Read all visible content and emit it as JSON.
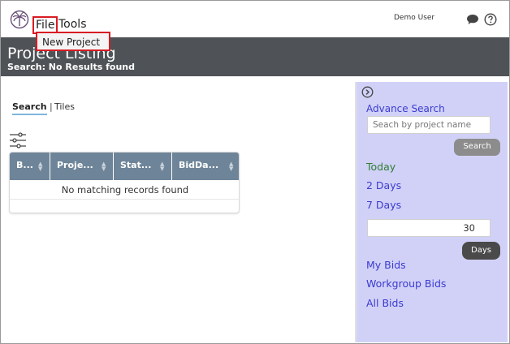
{
  "menu": {
    "file_label": "File",
    "tools_label": "Tools",
    "file_dropdown": {
      "new_project_label": "New Project"
    }
  },
  "user": {
    "name": "Demo User"
  },
  "header": {
    "title": "Project Listing",
    "subtitle": "Search: No Results found"
  },
  "view_tabs": {
    "search_label": "Search",
    "separator": "|",
    "tiles_label": "Tiles",
    "active": "Search"
  },
  "table": {
    "columns": [
      "B...",
      "Proje...",
      "Stat...",
      "BidDa..."
    ],
    "empty_message": "No matching records found"
  },
  "side_panel": {
    "advance_search_label": "Advance Search",
    "search_placeholder": "Seach by project name",
    "search_button_label": "Search",
    "quick_filters": {
      "today": "Today",
      "two_days": "2 Days",
      "seven_days": "7 Days"
    },
    "days_value": "30",
    "days_button_label": "Days",
    "bid_links": {
      "my_bids": "My Bids",
      "workgroup_bids": "Workgroup Bids",
      "all_bids": "All Bids"
    }
  },
  "icons": {
    "logo": "palm-logo-icon",
    "chat": "chat-icon",
    "help": "help-icon",
    "filter": "filter-sliders-icon",
    "collapse": "chevron-right-circle-icon",
    "sort": "sort-icon"
  },
  "colors": {
    "header_band": "#4f5357",
    "table_header": "#6e8599",
    "side_panel": "#d1d1f8",
    "link": "#3b3bd0",
    "today_link": "#2e7d32",
    "highlight_border": "#d81b23"
  }
}
